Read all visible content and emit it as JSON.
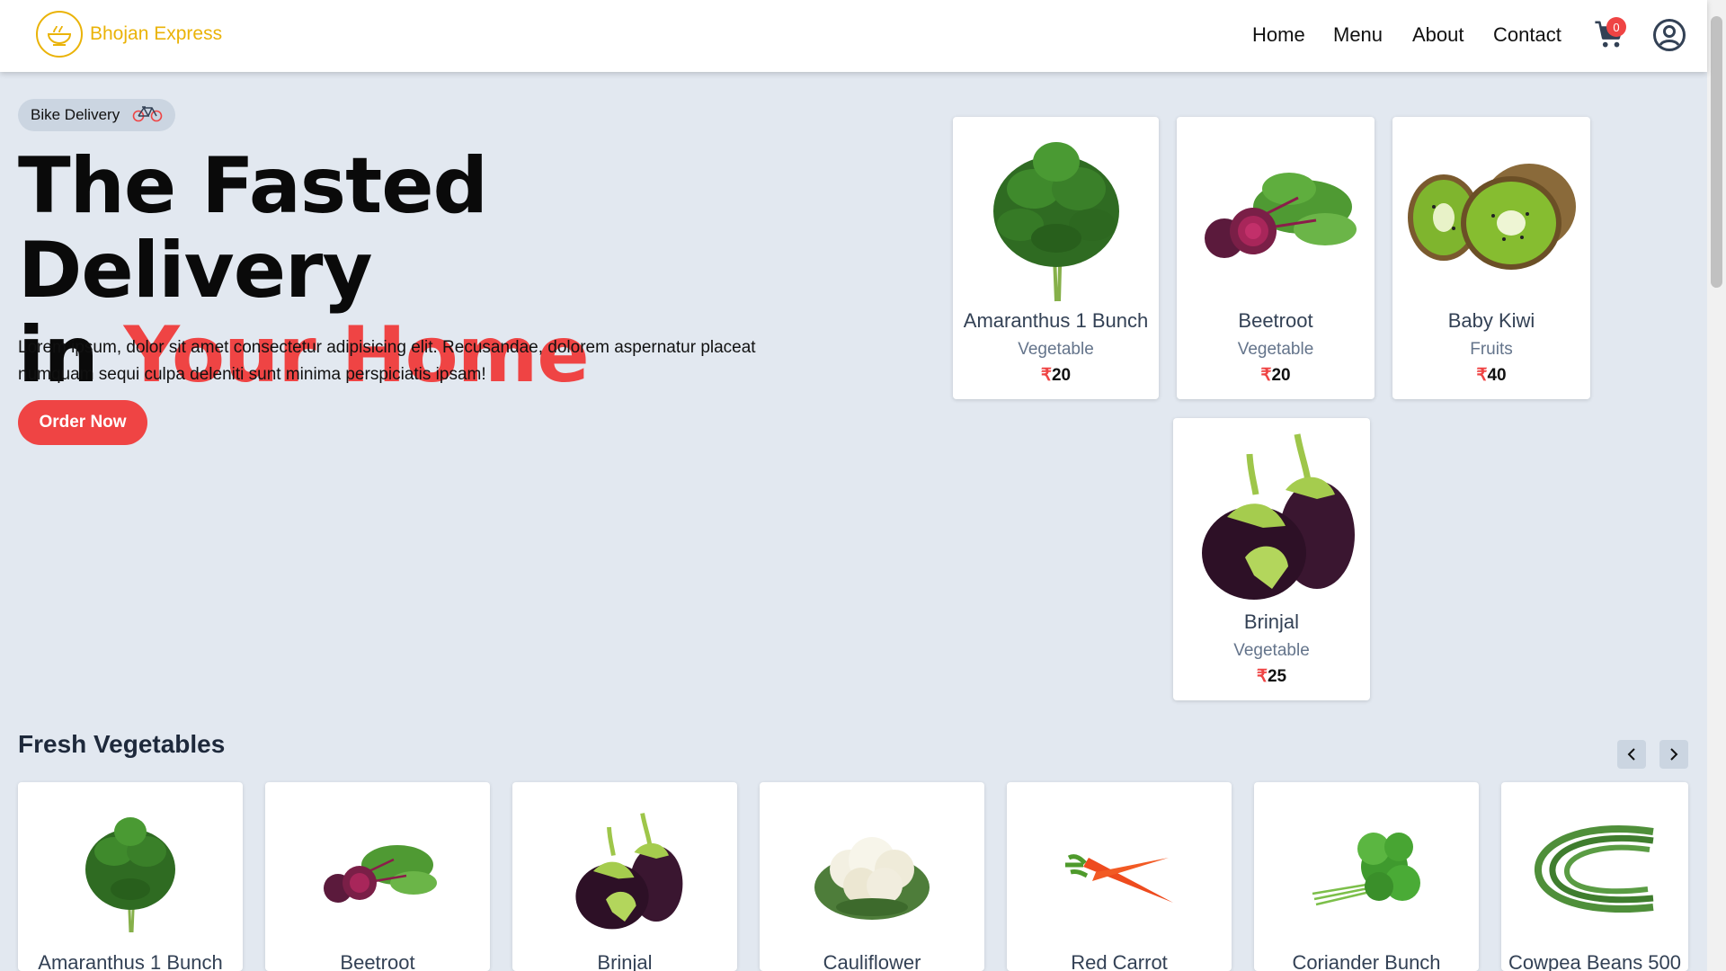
{
  "brand": {
    "name": "Bhojan Express"
  },
  "nav": {
    "home": "Home",
    "menu": "Menu",
    "about": "About",
    "contact": "Contact"
  },
  "cart": {
    "count": "0"
  },
  "hero": {
    "pill_label": "Bike Delivery",
    "title_line1": "The Fasted Delivery",
    "title_in": "in ",
    "title_accent": "Your Home",
    "description": "Lorem ipsum, dolor sit amet consectetur adipisicing elit. Recusandae, dolorem aspernatur placeat numquam sequi culpa deleniti sunt minima perspiciatis ipsam!",
    "cta": "Order Now"
  },
  "hero_cards": [
    {
      "name": "Amaranthus 1 Bunch",
      "category": "Vegetable",
      "currency": "₹",
      "price": "20",
      "icon": "amaranthus-image"
    },
    {
      "name": "Beetroot",
      "category": "Vegetable",
      "currency": "₹",
      "price": "20",
      "icon": "beetroot-image"
    },
    {
      "name": "Baby Kiwi",
      "category": "Fruits",
      "currency": "₹",
      "price": "40",
      "icon": "kiwi-image"
    },
    {
      "name": "Brinjal",
      "category": "Vegetable",
      "currency": "₹",
      "price": "25",
      "icon": "brinjal-image"
    }
  ],
  "section": {
    "title": "Fresh Vegetables",
    "items": [
      {
        "name": "Amaranthus 1 Bunch",
        "icon": "amaranthus-image"
      },
      {
        "name": "Beetroot",
        "icon": "beetroot-image"
      },
      {
        "name": "Brinjal",
        "icon": "brinjal-image"
      },
      {
        "name": "Cauliflower",
        "icon": "cauliflower-image"
      },
      {
        "name": "Red Carrot",
        "icon": "carrot-image"
      },
      {
        "name": "Coriander Bunch",
        "icon": "coriander-image"
      },
      {
        "name": "Cowpea Beans 500",
        "icon": "beans-image"
      }
    ]
  },
  "colors": {
    "accent": "#ef4444",
    "brand": "#eab308",
    "background": "#e2e8f0"
  }
}
